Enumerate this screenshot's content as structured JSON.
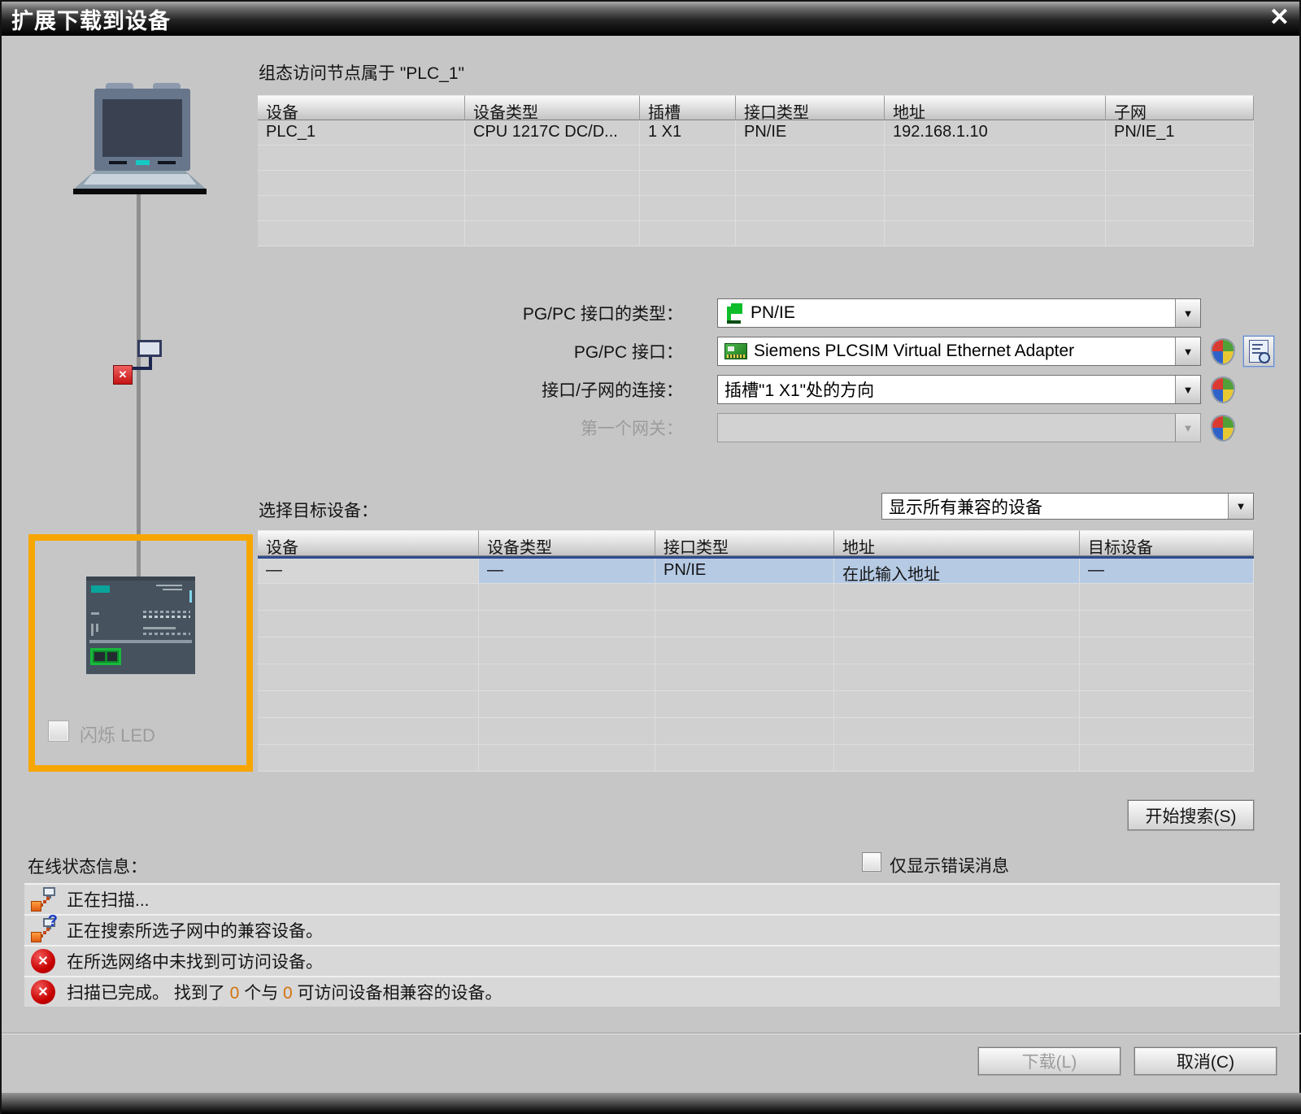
{
  "window": {
    "title": "扩展下载到设备",
    "close_glyph": "✕"
  },
  "config": {
    "caption": "组态访问节点属于 \"PLC_1\"",
    "headers": [
      "设备",
      "设备类型",
      "插槽",
      "接口类型",
      "地址",
      "子网"
    ],
    "row": [
      "PLC_1",
      "CPU 1217C DC/D...",
      "1 X1",
      "PN/IE",
      "192.168.1.10",
      "PN/IE_1"
    ]
  },
  "pgpc": {
    "type_label": "PG/PC 接口的类型：",
    "type_value": "PN/IE",
    "if_label": "PG/PC 接口：",
    "if_value": "Siemens PLCSIM Virtual Ethernet Adapter",
    "conn_label": "接口/子网的连接：",
    "conn_value": "插槽\"1 X1\"处的方向",
    "gw_label": "第一个网关：",
    "gw_value": ""
  },
  "target": {
    "select_label": "选择目标设备：",
    "filter_value": "显示所有兼容的设备",
    "headers": [
      "设备",
      "设备类型",
      "接口类型",
      "地址",
      "目标设备"
    ],
    "row": [
      "—",
      "—",
      "PN/IE",
      "在此输入地址",
      "—"
    ],
    "flash_led": "闪烁 LED",
    "start_search": "开始搜索(S)"
  },
  "status": {
    "label": "在线状态信息：",
    "error_only": "仅显示错误消息",
    "msg1": "正在扫描...",
    "msg2": "正在搜索所选子网中的兼容设备。",
    "msg3": "在所选网络中未找到可访问设备。",
    "msg4_parts": [
      "扫描已完成。 找到了 ",
      "0",
      " 个与 ",
      "0",
      " 可访问设备相兼容的设备。"
    ]
  },
  "footer": {
    "download": "下载(L)",
    "cancel": "取消(C)"
  },
  "glyphs": {
    "arrow": "▼",
    "question": "?",
    "error_x": "✕"
  }
}
